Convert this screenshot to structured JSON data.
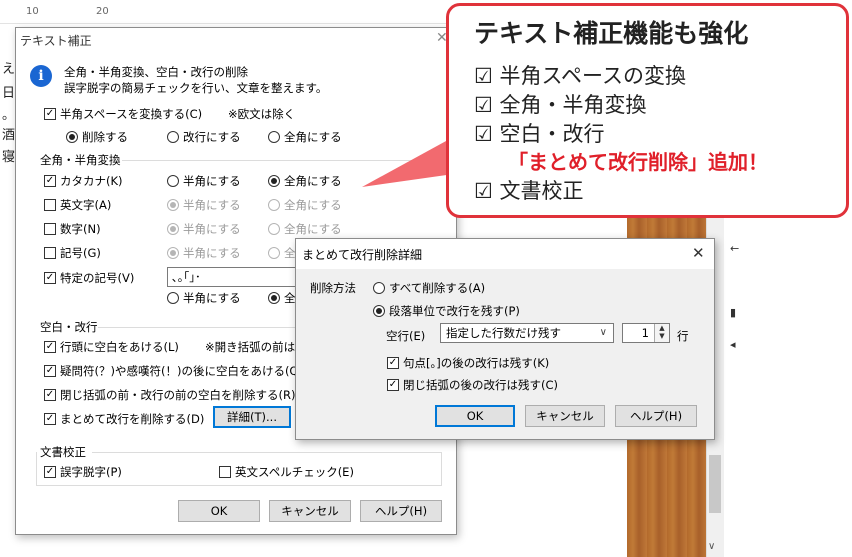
{
  "background": {
    "ruler": [
      "10",
      "20"
    ],
    "doc_chars": [
      "え",
      "日",
      "。",
      "酒",
      "寝"
    ],
    "side_marks": [
      "←",
      "▮",
      "◂"
    ]
  },
  "main_dialog": {
    "title": "テキスト補正",
    "intro_line1": "全角・半角変換、空白・改行の削除",
    "intro_line2": "誤字脱字の簡易チェックを行い、文章を整えます。",
    "halfspace_check": "半角スペースを変換する(C)",
    "halfspace_note": "※欧文は除く",
    "opt_delete": "削除する",
    "opt_newline": "改行にする",
    "opt_fullwidth": "全角にする",
    "section_width": "全角・半角変換",
    "rows": [
      {
        "label": "カタカナ(K)",
        "half": "半角にする",
        "full": "全角にする"
      },
      {
        "label": "英文字(A)",
        "half": "半角にする",
        "full": "全角にする"
      },
      {
        "label": "数字(N)",
        "half": "半角にする",
        "full": "全角にする"
      },
      {
        "label": "記号(G)",
        "half": "半角にする",
        "full": "全"
      }
    ],
    "special_label": "特定の記号(V)",
    "special_value": "､｡｢｣･",
    "special_half": "半角にする",
    "special_full": "全",
    "section_space": "空白・改行",
    "space_items": [
      "行頭に空白をあける(L)",
      "疑問符(？)や感嘆符(！)の後に空白をあける(Q)",
      "閉じ括弧の前・改行の前の空白を削除する(R)",
      "まとめて改行を削除する(D)"
    ],
    "space_note": "※開き括弧の前は削",
    "detail_button": "詳細(T)...",
    "section_proof": "文書校正",
    "proof_typo": "誤字脱字(P)",
    "proof_spell": "英文スペルチェック(E)",
    "ok": "OK",
    "cancel": "キャンセル",
    "help": "ヘルプ(H)"
  },
  "sub_dialog": {
    "title": "まとめて改行削除詳細",
    "method_label": "削除方法",
    "opt_all": "すべて削除する(A)",
    "opt_paragraph": "段落単位で改行を残す(P)",
    "blankline_label": "空行(E)",
    "blankline_select": "指定した行数だけ残す",
    "spin_value": "1",
    "spin_unit": "行",
    "keep_period": "句点[。]の後の改行は残す(K)",
    "keep_bracket": "閉じ括弧の後の改行は残す(C)",
    "ok": "OK",
    "cancel": "キャンセル",
    "help": "ヘルプ(H)"
  },
  "callout": {
    "title": "テキスト補正機能も強化",
    "items": [
      "☑ 半角スペースの変換",
      "☑ 全角・半角変換",
      "☑ 空白・改行",
      "☑ 文書校正"
    ],
    "highlight": "「まとめて改行削除」追加！",
    "accent_color": "#e0323a"
  },
  "checkmark": "✓"
}
